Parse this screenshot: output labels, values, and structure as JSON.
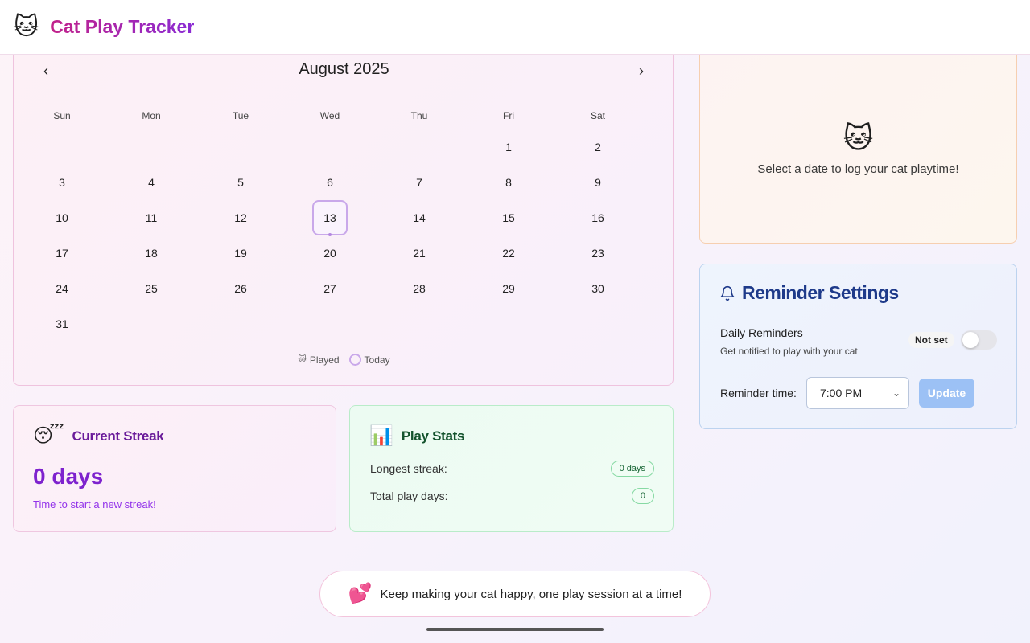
{
  "header": {
    "logo_emoji": "🐱",
    "title": "Cat Play Tracker"
  },
  "calendar": {
    "prev_label": "‹",
    "next_label": "›",
    "month_label": "August 2025",
    "weekdays": [
      "Sun",
      "Mon",
      "Tue",
      "Wed",
      "Thu",
      "Fri",
      "Sat"
    ],
    "days": [
      "1",
      "2",
      "3",
      "4",
      "5",
      "6",
      "7",
      "8",
      "9",
      "10",
      "11",
      "12",
      "13",
      "14",
      "15",
      "16",
      "17",
      "18",
      "19",
      "20",
      "21",
      "22",
      "23",
      "24",
      "25",
      "26",
      "27",
      "28",
      "29",
      "30",
      "31"
    ],
    "first_weekday_index": 5,
    "today": "13",
    "legend": {
      "played_icon": "🐱",
      "played_label": "Played",
      "today_label": "Today"
    }
  },
  "streak": {
    "emoji": "😴",
    "title": "Current Streak",
    "value": "0 days",
    "subtitle": "Time to start a new streak!"
  },
  "stats": {
    "emoji": "📊",
    "title": "Play Stats",
    "rows": [
      {
        "label": "Longest streak:",
        "value": "0 days"
      },
      {
        "label": "Total play days:",
        "value": "0"
      }
    ]
  },
  "log": {
    "icon": "🐱",
    "message": "Select a date to log your cat playtime!"
  },
  "reminder": {
    "title": "Reminder Settings",
    "daily_label": "Daily Reminders",
    "daily_sub": "Get notified to play with your cat",
    "status_badge": "Not set",
    "toggle_on": false,
    "time_label": "Reminder time:",
    "time_value": "7:00 PM",
    "update_label": "Update"
  },
  "footer": {
    "emoji": "💕",
    "message": "Keep making your cat happy, one play session at a time!"
  }
}
